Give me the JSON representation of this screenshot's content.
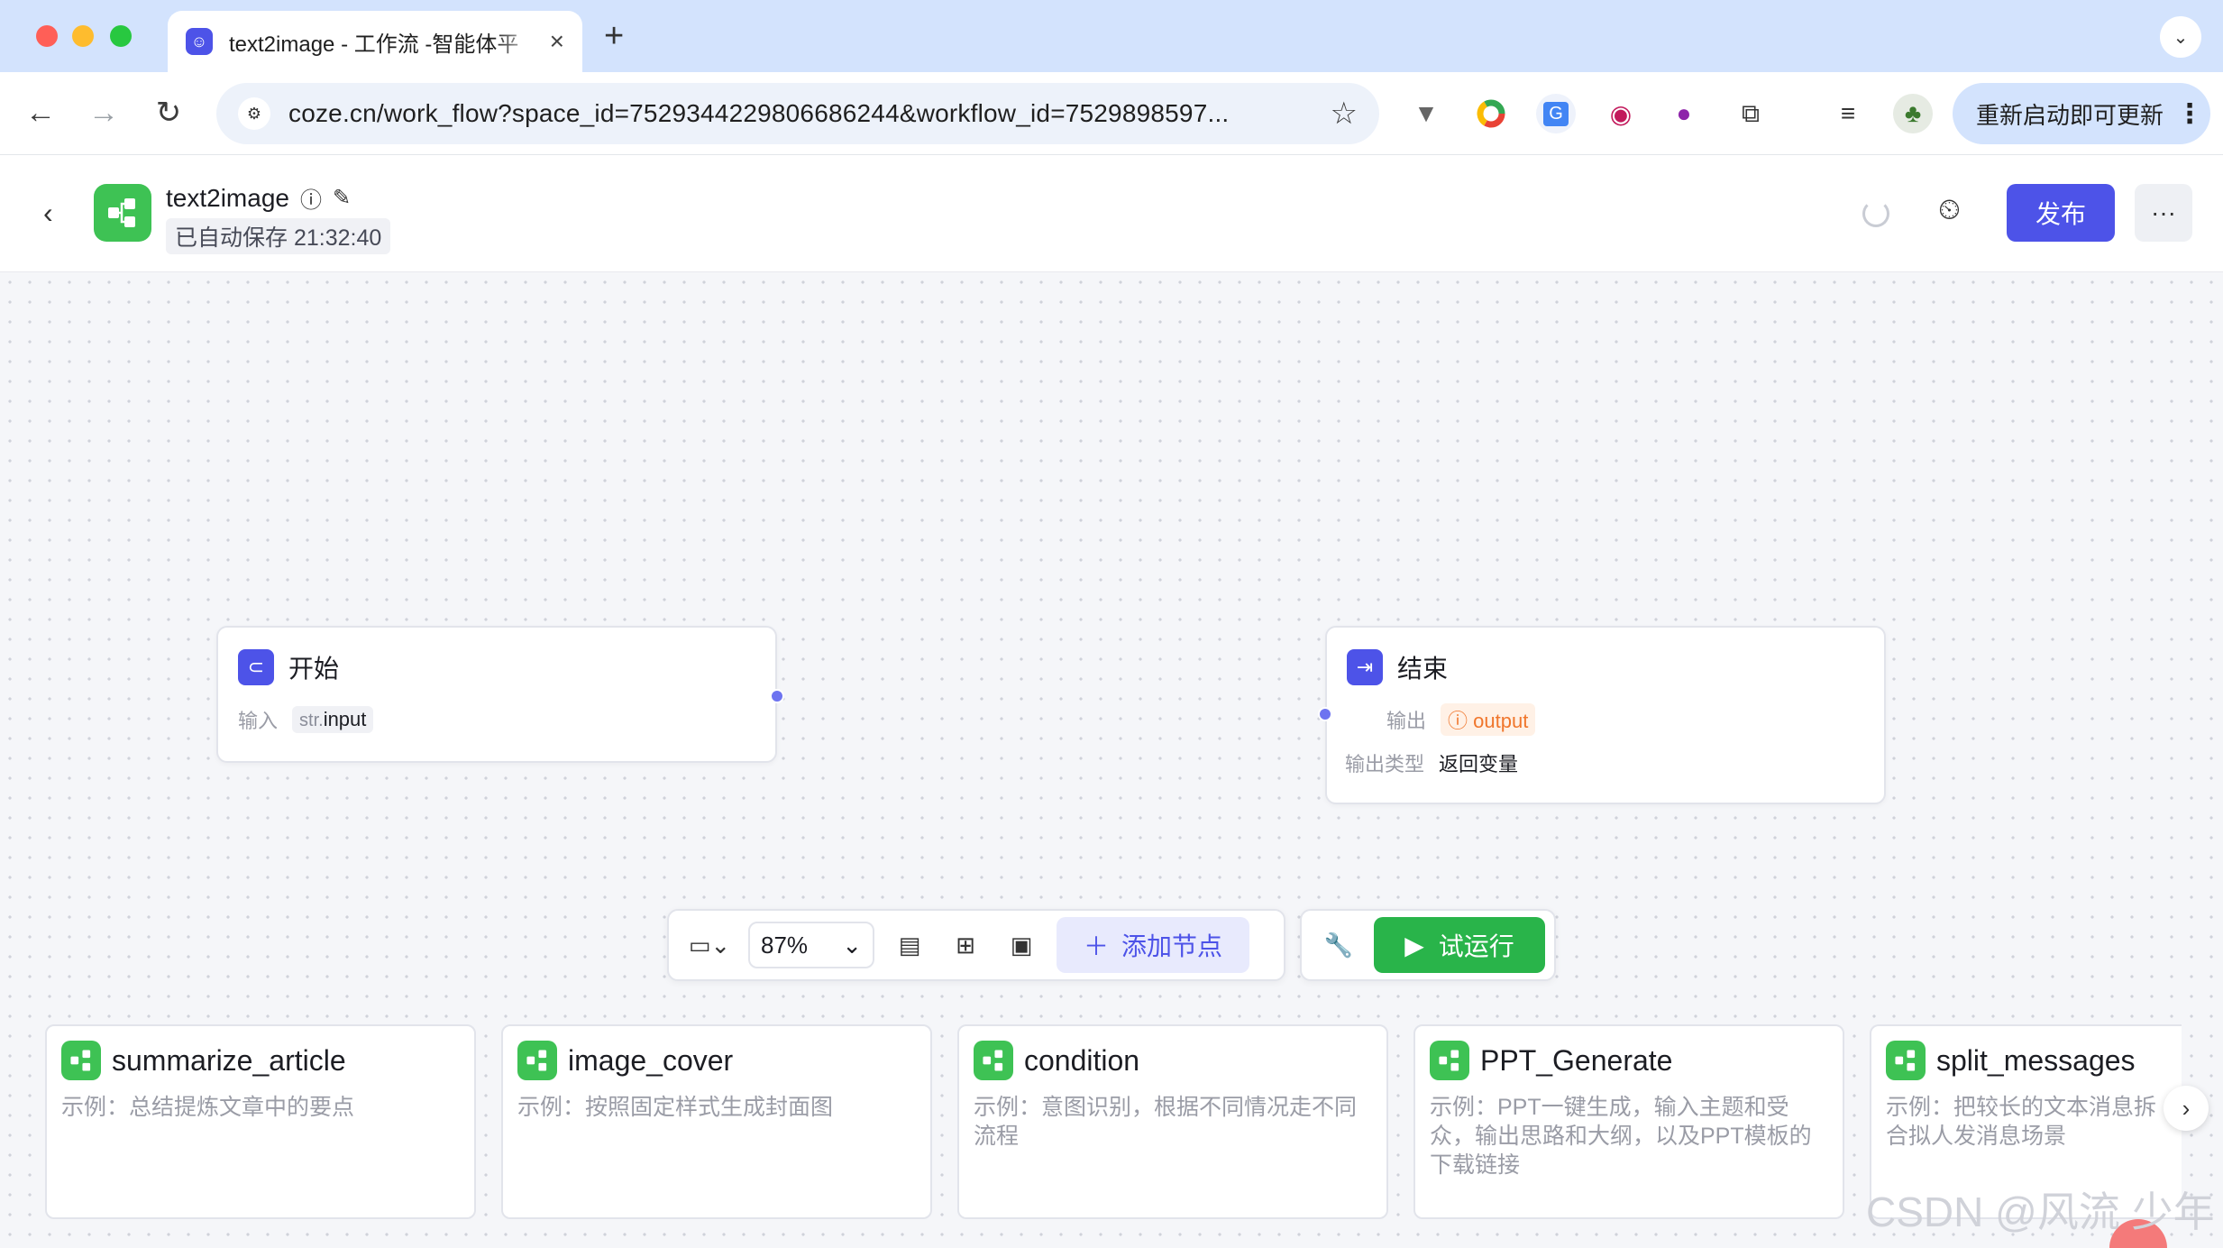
{
  "browser": {
    "tab_title": "text2image - 工作流 -智能体平",
    "tab_close": "×",
    "new_tab": "+",
    "url": "coze.cn/work_flow?space_id=7529344229806686244&workflow_id=7529898597...",
    "update_label": "重新启动即可更新",
    "update_more": "⋮"
  },
  "header": {
    "back": "‹",
    "title": "text2image",
    "saved": "已自动保存 21:32:40",
    "publish": "发布",
    "more": "···"
  },
  "nodes": {
    "start": {
      "title": "开始",
      "input_label": "输入",
      "input_type": "str.",
      "input_name": "input"
    },
    "end": {
      "title": "结束",
      "output_label": "输出",
      "output_name": "output",
      "output_type_label": "输出类型",
      "output_type_value": "返回变量"
    }
  },
  "controls": {
    "zoom": "87%",
    "add_node": "添加节点",
    "run": "试运行"
  },
  "templates": [
    {
      "name": "summarize_article",
      "desc": "示例：总结提炼文章中的要点"
    },
    {
      "name": "image_cover",
      "desc": "示例：按照固定样式生成封面图"
    },
    {
      "name": "condition",
      "desc": "示例：意图识别，根据不同情况走不同流程"
    },
    {
      "name": "PPT_Generate",
      "desc": "示例：PPT一键生成，输入主题和受众，输出思路和大纲，以及PPT模板的下载链接"
    },
    {
      "name": "split_messages",
      "desc": "示例：把较长的文本消息拆合拟人发消息场景"
    }
  ],
  "watermark": "CSDN @风流 少年",
  "colors": {
    "brand": "#4d53e8",
    "run": "#29b44a",
    "workflow_icon": "#3ec254"
  }
}
